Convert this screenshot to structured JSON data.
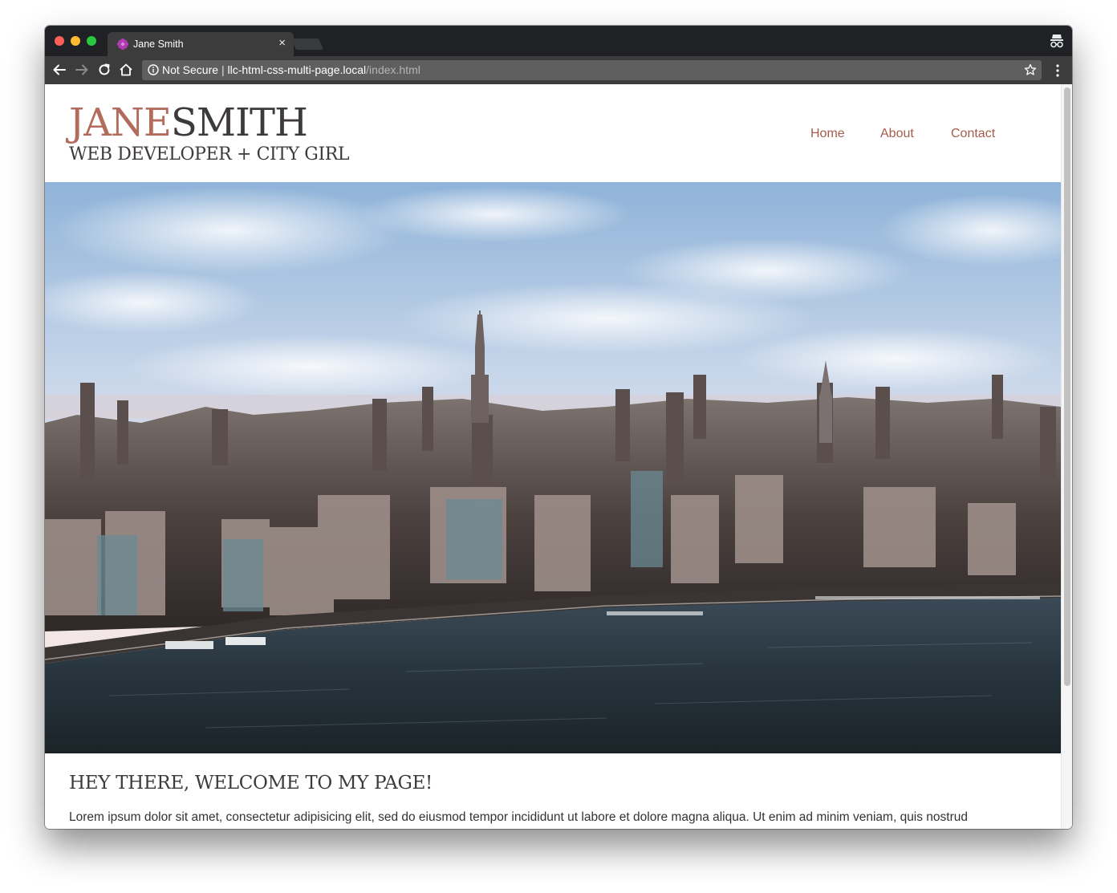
{
  "browser": {
    "tab_title": "Jane Smith",
    "tab_close": "×",
    "security_label": "Not Secure",
    "url_separator": "|",
    "url_host": "llc-html-css-multi-page.local",
    "url_path": "/index.html"
  },
  "icons": {
    "favicon": "favicon-flower-icon",
    "back": "arrow-left-icon",
    "forward": "arrow-right-icon",
    "reload": "reload-icon",
    "home": "home-icon",
    "info": "info-icon",
    "bookmark": "star-icon",
    "menu": "kebab-menu-icon",
    "profile": "incognito-icon"
  },
  "site": {
    "logo_first": "JANE",
    "logo_last": "SMITH",
    "tagline": "WEB DEVELOPER + CITY GIRL",
    "nav": [
      "Home",
      "About",
      "Contact"
    ],
    "heading": "HEY THERE, WELCOME TO MY PAGE!",
    "paragraph": "Lorem ipsum dolor sit amet, consectetur adipisicing elit, sed do eiusmod tempor incididunt ut labore et dolore magna aliqua. Ut enim ad minim veniam, quis nostrud"
  },
  "colors": {
    "accent": "#b36b5c",
    "nav_link": "#a65c4c",
    "text_dark": "#3e3a3b",
    "chrome_dark": "#202124",
    "toolbar": "#3c3c3c"
  }
}
